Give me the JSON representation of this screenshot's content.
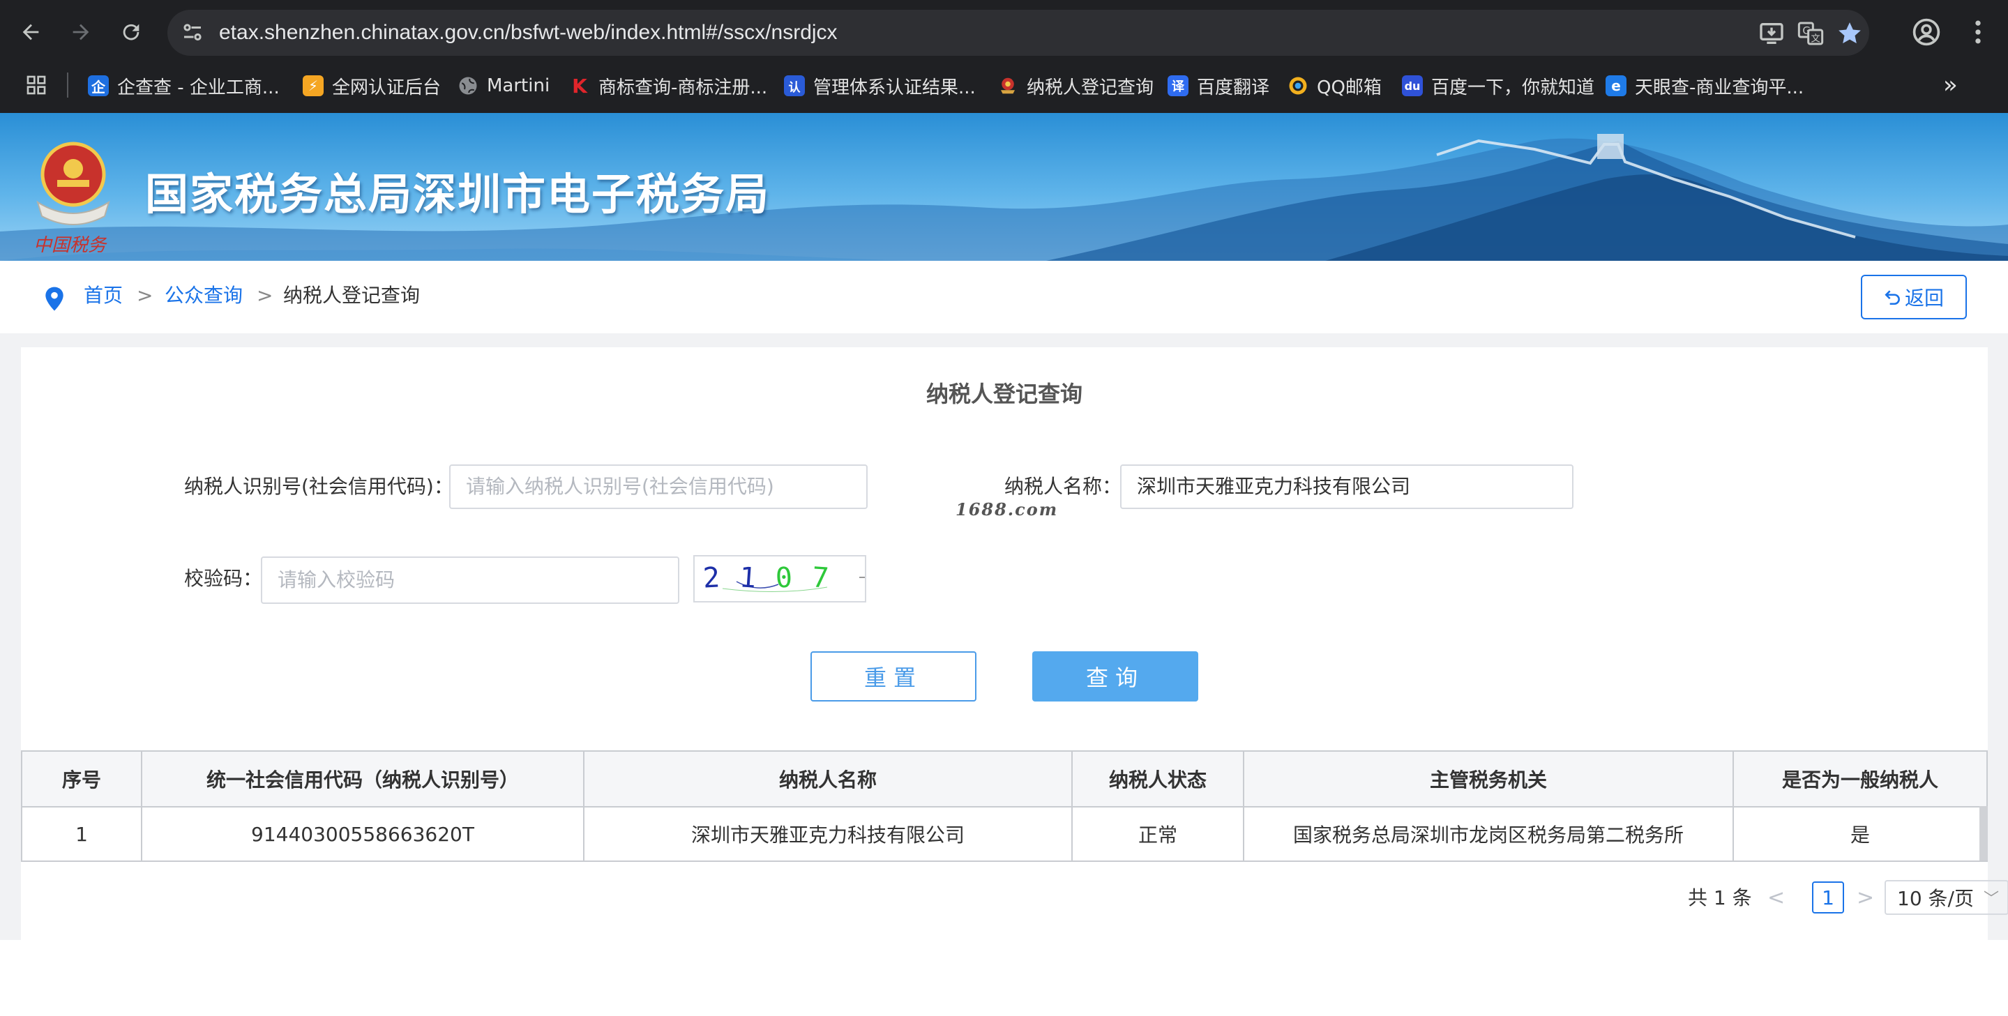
{
  "browser": {
    "url": "etax.shenzhen.chinatax.gov.cn/bsfwt-web/index.html#/sscx/nsrdjcx",
    "bookmarks": [
      {
        "label": "企查查 - 企业工商...",
        "icon": "qichacha-icon",
        "color": "#1e6fe0"
      },
      {
        "label": "全网认证后台",
        "icon": "auth-backend-icon",
        "color": "#f5a623"
      },
      {
        "label": "Martini",
        "icon": "globe-icon",
        "color": "#8a8d91"
      },
      {
        "label": "商标查询-商标注册...",
        "icon": "trademark-k-icon",
        "color": "#e0252b"
      },
      {
        "label": "管理体系认证结果...",
        "icon": "certification-icon",
        "color": "#2a5bd7"
      },
      {
        "label": "纳税人登记查询",
        "icon": "tax-emblem-icon",
        "color": "#c8322c"
      },
      {
        "label": "百度翻译",
        "icon": "baidu-translate-icon",
        "color": "#2f6cf0"
      },
      {
        "label": "QQ邮箱",
        "icon": "qq-mail-icon",
        "color": "#f2b01e"
      },
      {
        "label": "百度一下，你就知道",
        "icon": "baidu-paw-icon",
        "color": "#2f52d8"
      },
      {
        "label": "天眼查-商业查询平...",
        "icon": "tianyancha-icon",
        "color": "#1f7be8"
      }
    ],
    "more_label": "»"
  },
  "banner": {
    "title": "国家税务总局深圳市电子税务局"
  },
  "breadcrumb": {
    "home": "首页",
    "separator": ">",
    "section": "公众查询",
    "current": "纳税人登记查询",
    "back_label": "返回"
  },
  "form": {
    "title": "纳税人登记查询",
    "taxpayer_id_label": "纳税人识别号(社会信用代码)：",
    "taxpayer_id_placeholder": "请输入纳税人识别号(社会信用代码)",
    "taxpayer_name_label": "纳税人名称：",
    "taxpayer_name_value": "深圳市天雅亚克力科技有限公司",
    "watermark": "1688.com",
    "captcha_label": "校验码：",
    "captcha_placeholder": "请输入校验码",
    "captcha_chars": [
      "2",
      "1",
      "0",
      "7"
    ],
    "captcha_colors": [
      "#1d2fa8",
      "#1d2fa8",
      "#2ec83a",
      "#2ec83a"
    ],
    "reset_label": "重置",
    "query_label": "查询"
  },
  "table": {
    "headers": [
      "序号",
      "统一社会信用代码（纳税人识别号）",
      "纳税人名称",
      "纳税人状态",
      "主管税务机关",
      "是否为一般纳税人"
    ],
    "rows": [
      [
        "1",
        "91440300558663620T",
        "深圳市天雅亚克力科技有限公司",
        "正常",
        "国家税务总局深圳市龙岗区税务局第二税务所",
        "是"
      ]
    ]
  },
  "pagination": {
    "total": "共 1 条",
    "prev": "<",
    "current_page": "1",
    "next": ">",
    "page_size": "10 条/页"
  },
  "colors": {
    "accent": "#1a73e8",
    "query_button": "#54a9ee",
    "chrome_bg": "#1f2023"
  }
}
